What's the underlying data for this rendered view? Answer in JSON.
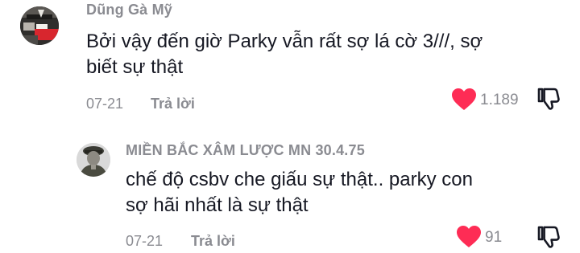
{
  "comments": [
    {
      "username": "Dũng Gà Mỹ",
      "text_line1": "Bởi vậy đến giờ Parky vẫn rất sợ lá cờ 3///, sợ",
      "text_line2": "biết sự thật",
      "date": "07-21",
      "reply_label": "Trả lời",
      "like_count": "1.189",
      "liked": true
    },
    {
      "username": "MIỀN BẮC XÂM LƯỢC MN 30.4.75",
      "text_line1": "chế độ csbv che giấu sự thật.. parky con",
      "text_line2": "sợ hãi nhất là sự thật",
      "date": "07-21",
      "reply_label": "Trả lời",
      "like_count": "91",
      "liked": true
    }
  ],
  "colors": {
    "like_active": "#fe2c55",
    "meta_text": "#8a8b91",
    "body_text": "#161823"
  },
  "icons": {
    "like": "heart-icon",
    "dislike": "thumbs-down-icon"
  }
}
